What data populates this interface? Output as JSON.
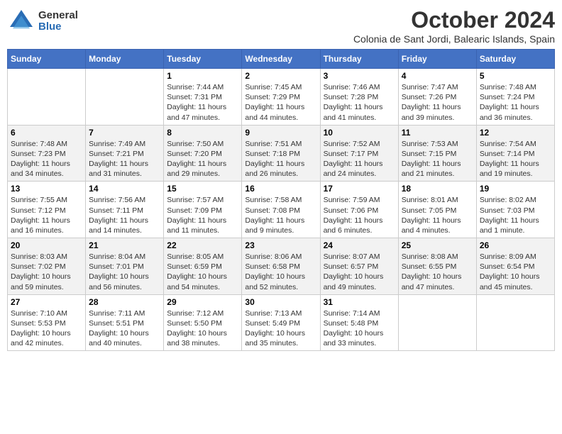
{
  "logo": {
    "general": "General",
    "blue": "Blue"
  },
  "title": "October 2024",
  "subtitle": "Colonia de Sant Jordi, Balearic Islands, Spain",
  "days_of_week": [
    "Sunday",
    "Monday",
    "Tuesday",
    "Wednesday",
    "Thursday",
    "Friday",
    "Saturday"
  ],
  "weeks": [
    [
      {
        "day": "",
        "sunrise": "",
        "sunset": "",
        "daylight": ""
      },
      {
        "day": "",
        "sunrise": "",
        "sunset": "",
        "daylight": ""
      },
      {
        "day": "1",
        "sunrise": "Sunrise: 7:44 AM",
        "sunset": "Sunset: 7:31 PM",
        "daylight": "Daylight: 11 hours and 47 minutes."
      },
      {
        "day": "2",
        "sunrise": "Sunrise: 7:45 AM",
        "sunset": "Sunset: 7:29 PM",
        "daylight": "Daylight: 11 hours and 44 minutes."
      },
      {
        "day": "3",
        "sunrise": "Sunrise: 7:46 AM",
        "sunset": "Sunset: 7:28 PM",
        "daylight": "Daylight: 11 hours and 41 minutes."
      },
      {
        "day": "4",
        "sunrise": "Sunrise: 7:47 AM",
        "sunset": "Sunset: 7:26 PM",
        "daylight": "Daylight: 11 hours and 39 minutes."
      },
      {
        "day": "5",
        "sunrise": "Sunrise: 7:48 AM",
        "sunset": "Sunset: 7:24 PM",
        "daylight": "Daylight: 11 hours and 36 minutes."
      }
    ],
    [
      {
        "day": "6",
        "sunrise": "Sunrise: 7:48 AM",
        "sunset": "Sunset: 7:23 PM",
        "daylight": "Daylight: 11 hours and 34 minutes."
      },
      {
        "day": "7",
        "sunrise": "Sunrise: 7:49 AM",
        "sunset": "Sunset: 7:21 PM",
        "daylight": "Daylight: 11 hours and 31 minutes."
      },
      {
        "day": "8",
        "sunrise": "Sunrise: 7:50 AM",
        "sunset": "Sunset: 7:20 PM",
        "daylight": "Daylight: 11 hours and 29 minutes."
      },
      {
        "day": "9",
        "sunrise": "Sunrise: 7:51 AM",
        "sunset": "Sunset: 7:18 PM",
        "daylight": "Daylight: 11 hours and 26 minutes."
      },
      {
        "day": "10",
        "sunrise": "Sunrise: 7:52 AM",
        "sunset": "Sunset: 7:17 PM",
        "daylight": "Daylight: 11 hours and 24 minutes."
      },
      {
        "day": "11",
        "sunrise": "Sunrise: 7:53 AM",
        "sunset": "Sunset: 7:15 PM",
        "daylight": "Daylight: 11 hours and 21 minutes."
      },
      {
        "day": "12",
        "sunrise": "Sunrise: 7:54 AM",
        "sunset": "Sunset: 7:14 PM",
        "daylight": "Daylight: 11 hours and 19 minutes."
      }
    ],
    [
      {
        "day": "13",
        "sunrise": "Sunrise: 7:55 AM",
        "sunset": "Sunset: 7:12 PM",
        "daylight": "Daylight: 11 hours and 16 minutes."
      },
      {
        "day": "14",
        "sunrise": "Sunrise: 7:56 AM",
        "sunset": "Sunset: 7:11 PM",
        "daylight": "Daylight: 11 hours and 14 minutes."
      },
      {
        "day": "15",
        "sunrise": "Sunrise: 7:57 AM",
        "sunset": "Sunset: 7:09 PM",
        "daylight": "Daylight: 11 hours and 11 minutes."
      },
      {
        "day": "16",
        "sunrise": "Sunrise: 7:58 AM",
        "sunset": "Sunset: 7:08 PM",
        "daylight": "Daylight: 11 hours and 9 minutes."
      },
      {
        "day": "17",
        "sunrise": "Sunrise: 7:59 AM",
        "sunset": "Sunset: 7:06 PM",
        "daylight": "Daylight: 11 hours and 6 minutes."
      },
      {
        "day": "18",
        "sunrise": "Sunrise: 8:01 AM",
        "sunset": "Sunset: 7:05 PM",
        "daylight": "Daylight: 11 hours and 4 minutes."
      },
      {
        "day": "19",
        "sunrise": "Sunrise: 8:02 AM",
        "sunset": "Sunset: 7:03 PM",
        "daylight": "Daylight: 11 hours and 1 minute."
      }
    ],
    [
      {
        "day": "20",
        "sunrise": "Sunrise: 8:03 AM",
        "sunset": "Sunset: 7:02 PM",
        "daylight": "Daylight: 10 hours and 59 minutes."
      },
      {
        "day": "21",
        "sunrise": "Sunrise: 8:04 AM",
        "sunset": "Sunset: 7:01 PM",
        "daylight": "Daylight: 10 hours and 56 minutes."
      },
      {
        "day": "22",
        "sunrise": "Sunrise: 8:05 AM",
        "sunset": "Sunset: 6:59 PM",
        "daylight": "Daylight: 10 hours and 54 minutes."
      },
      {
        "day": "23",
        "sunrise": "Sunrise: 8:06 AM",
        "sunset": "Sunset: 6:58 PM",
        "daylight": "Daylight: 10 hours and 52 minutes."
      },
      {
        "day": "24",
        "sunrise": "Sunrise: 8:07 AM",
        "sunset": "Sunset: 6:57 PM",
        "daylight": "Daylight: 10 hours and 49 minutes."
      },
      {
        "day": "25",
        "sunrise": "Sunrise: 8:08 AM",
        "sunset": "Sunset: 6:55 PM",
        "daylight": "Daylight: 10 hours and 47 minutes."
      },
      {
        "day": "26",
        "sunrise": "Sunrise: 8:09 AM",
        "sunset": "Sunset: 6:54 PM",
        "daylight": "Daylight: 10 hours and 45 minutes."
      }
    ],
    [
      {
        "day": "27",
        "sunrise": "Sunrise: 7:10 AM",
        "sunset": "Sunset: 5:53 PM",
        "daylight": "Daylight: 10 hours and 42 minutes."
      },
      {
        "day": "28",
        "sunrise": "Sunrise: 7:11 AM",
        "sunset": "Sunset: 5:51 PM",
        "daylight": "Daylight: 10 hours and 40 minutes."
      },
      {
        "day": "29",
        "sunrise": "Sunrise: 7:12 AM",
        "sunset": "Sunset: 5:50 PM",
        "daylight": "Daylight: 10 hours and 38 minutes."
      },
      {
        "day": "30",
        "sunrise": "Sunrise: 7:13 AM",
        "sunset": "Sunset: 5:49 PM",
        "daylight": "Daylight: 10 hours and 35 minutes."
      },
      {
        "day": "31",
        "sunrise": "Sunrise: 7:14 AM",
        "sunset": "Sunset: 5:48 PM",
        "daylight": "Daylight: 10 hours and 33 minutes."
      },
      {
        "day": "",
        "sunrise": "",
        "sunset": "",
        "daylight": ""
      },
      {
        "day": "",
        "sunrise": "",
        "sunset": "",
        "daylight": ""
      }
    ]
  ]
}
